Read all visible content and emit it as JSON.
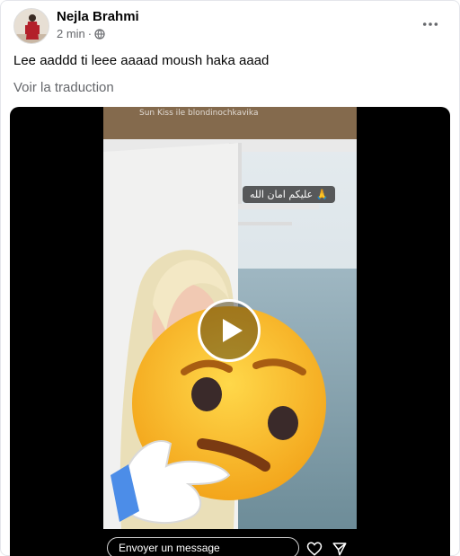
{
  "post": {
    "author": "Nejla Brahmi",
    "timestamp": "2 min",
    "separator": "·",
    "privacy_icon": "globe-icon",
    "more_icon": "more-dots-icon",
    "text": "Lee aaddd ti leee aaaad moush haka aaad",
    "translate_label": "Voir la traduction"
  },
  "video": {
    "watermark": "Sun Kiss ile blondinochkavika",
    "sticker_text": "عليكم امان الله 🙏",
    "play_icon": "play-icon",
    "message_placeholder": "Envoyer un message",
    "like_icon": "heart-icon",
    "send_icon": "send-icon"
  },
  "colors": {
    "text_primary": "#050505",
    "text_secondary": "#65676b",
    "video_bg": "#000000"
  }
}
